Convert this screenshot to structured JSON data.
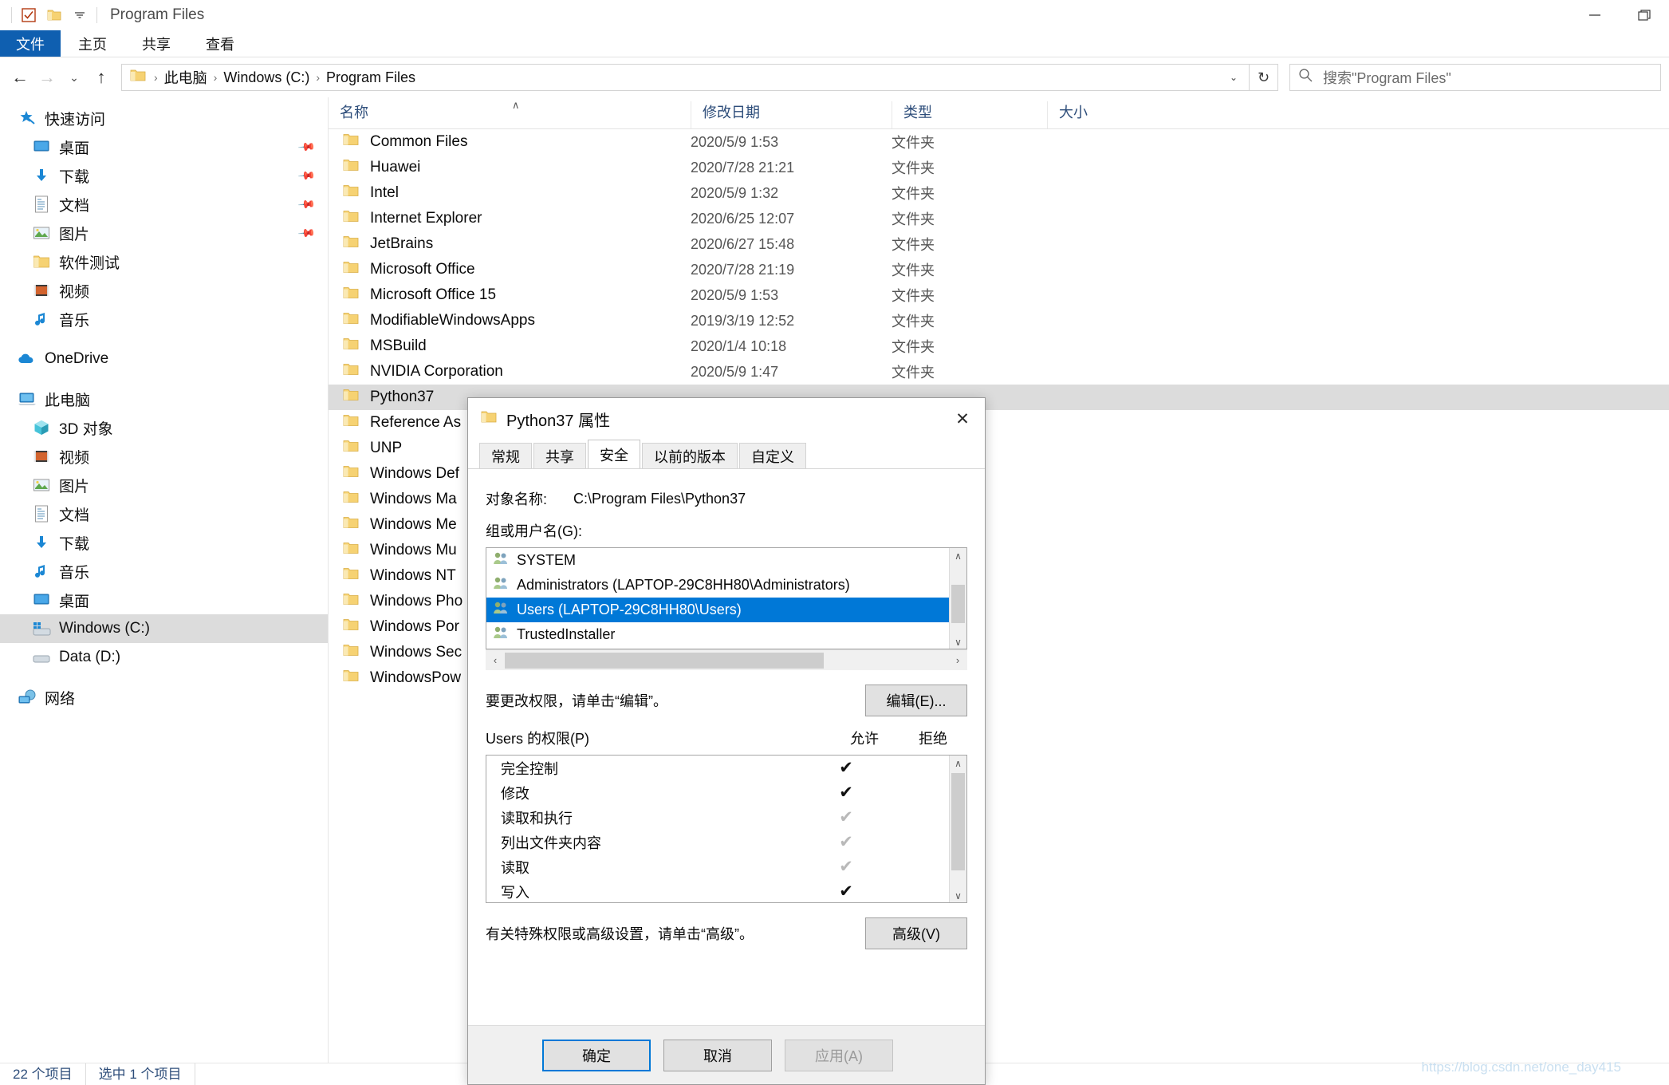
{
  "window": {
    "title": "Program Files",
    "quick_access_icons": [
      "properties-checkbox-icon",
      "folder-icon",
      "chevron-down-icon"
    ],
    "controls": {
      "minimize": "—",
      "maximize": "❐",
      "close": ""
    }
  },
  "ribbon": {
    "tabs": [
      {
        "label": "文件",
        "active_style": "file"
      },
      {
        "label": "主页"
      },
      {
        "label": "共享"
      },
      {
        "label": "查看"
      }
    ]
  },
  "address": {
    "back": "←",
    "forward": "→",
    "recent": "⌄",
    "up": "↑",
    "crumbs": [
      "此电脑",
      "Windows (C:)",
      "Program Files"
    ],
    "separator": "›",
    "dropdown": "⌄",
    "refresh": "↻"
  },
  "search": {
    "placeholder": "搜索\"Program Files\"",
    "icon": "search-icon"
  },
  "sidebar": {
    "groups": [
      {
        "root": {
          "label": "快速访问",
          "icon": "star-pin-icon"
        },
        "items": [
          {
            "label": "桌面",
            "icon": "desktop-icon",
            "pinned": true
          },
          {
            "label": "下载",
            "icon": "download-icon",
            "pinned": true
          },
          {
            "label": "文档",
            "icon": "documents-icon",
            "pinned": true
          },
          {
            "label": "图片",
            "icon": "pictures-icon",
            "pinned": true
          },
          {
            "label": "软件测试",
            "icon": "folder-icon",
            "pinned": false
          },
          {
            "label": "视频",
            "icon": "videos-icon",
            "pinned": false
          },
          {
            "label": "音乐",
            "icon": "music-icon",
            "pinned": false
          }
        ]
      },
      {
        "root": {
          "label": "OneDrive",
          "icon": "onedrive-cloud-icon"
        },
        "items": []
      },
      {
        "root": {
          "label": "此电脑",
          "icon": "this-pc-icon"
        },
        "items": [
          {
            "label": "3D 对象",
            "icon": "3d-objects-icon",
            "pinned": false
          },
          {
            "label": "视频",
            "icon": "videos-icon",
            "pinned": false
          },
          {
            "label": "图片",
            "icon": "pictures-icon",
            "pinned": false
          },
          {
            "label": "文档",
            "icon": "documents-icon",
            "pinned": false
          },
          {
            "label": "下载",
            "icon": "download-icon",
            "pinned": false
          },
          {
            "label": "音乐",
            "icon": "music-icon",
            "pinned": false
          },
          {
            "label": "桌面",
            "icon": "desktop-icon",
            "pinned": false
          },
          {
            "label": "Windows (C:)",
            "icon": "windows-drive-icon",
            "pinned": false,
            "selected": true
          },
          {
            "label": "Data (D:)",
            "icon": "drive-icon",
            "pinned": false
          }
        ]
      },
      {
        "root": {
          "label": "网络",
          "icon": "network-icon"
        },
        "items": []
      }
    ]
  },
  "filelist": {
    "columns": [
      {
        "label": "名称",
        "key": "name"
      },
      {
        "label": "修改日期",
        "key": "date"
      },
      {
        "label": "类型",
        "key": "type"
      },
      {
        "label": "大小",
        "key": "size"
      }
    ],
    "sort_indicator": "∧",
    "rows": [
      {
        "name": "Common Files",
        "date": "2020/5/9 1:53",
        "type": "文件夹",
        "size": ""
      },
      {
        "name": "Huawei",
        "date": "2020/7/28 21:21",
        "type": "文件夹",
        "size": ""
      },
      {
        "name": "Intel",
        "date": "2020/5/9 1:32",
        "type": "文件夹",
        "size": ""
      },
      {
        "name": "Internet Explorer",
        "date": "2020/6/25 12:07",
        "type": "文件夹",
        "size": ""
      },
      {
        "name": "JetBrains",
        "date": "2020/6/27 15:48",
        "type": "文件夹",
        "size": ""
      },
      {
        "name": "Microsoft Office",
        "date": "2020/7/28 21:19",
        "type": "文件夹",
        "size": ""
      },
      {
        "name": "Microsoft Office 15",
        "date": "2020/5/9 1:53",
        "type": "文件夹",
        "size": ""
      },
      {
        "name": "ModifiableWindowsApps",
        "date": "2019/3/19 12:52",
        "type": "文件夹",
        "size": ""
      },
      {
        "name": "MSBuild",
        "date": "2020/1/4 10:18",
        "type": "文件夹",
        "size": ""
      },
      {
        "name": "NVIDIA Corporation",
        "date": "2020/5/9 1:47",
        "type": "文件夹",
        "size": ""
      },
      {
        "name": "Python37",
        "date": "",
        "type": "",
        "size": "",
        "selected": true
      },
      {
        "name": "Reference As",
        "date": "",
        "type": "",
        "size": ""
      },
      {
        "name": "UNP",
        "date": "",
        "type": "",
        "size": ""
      },
      {
        "name": "Windows Def",
        "date": "",
        "type": "",
        "size": ""
      },
      {
        "name": "Windows Ma",
        "date": "",
        "type": "",
        "size": ""
      },
      {
        "name": "Windows Me",
        "date": "",
        "type": "",
        "size": ""
      },
      {
        "name": "Windows Mu",
        "date": "",
        "type": "",
        "size": ""
      },
      {
        "name": "Windows NT",
        "date": "",
        "type": "",
        "size": ""
      },
      {
        "name": "Windows Pho",
        "date": "",
        "type": "",
        "size": ""
      },
      {
        "name": "Windows Por",
        "date": "",
        "type": "",
        "size": ""
      },
      {
        "name": "Windows Sec",
        "date": "",
        "type": "",
        "size": ""
      },
      {
        "name": "WindowsPow",
        "date": "",
        "type": "",
        "size": ""
      }
    ]
  },
  "statusbar": {
    "item_count": "22 个项目",
    "selection": "选中 1 个项目"
  },
  "watermark": "https://blog.csdn.net/one_day415",
  "dialog": {
    "title": "Python37 属性",
    "close_glyph": "✕",
    "tabs": [
      {
        "label": "常规",
        "active": false
      },
      {
        "label": "共享",
        "active": false
      },
      {
        "label": "安全",
        "active": true
      },
      {
        "label": "以前的版本",
        "active": false
      },
      {
        "label": "自定义",
        "active": false
      }
    ],
    "object_name_label": "对象名称:",
    "object_name_value": "C:\\Program Files\\Python37",
    "group_label": "组或用户名(G):",
    "groups": [
      {
        "name": "SYSTEM",
        "selected": false
      },
      {
        "name": "Administrators (LAPTOP-29C8HH80\\Administrators)",
        "selected": false
      },
      {
        "name": "Users (LAPTOP-29C8HH80\\Users)",
        "selected": true
      },
      {
        "name": "TrustedInstaller",
        "selected": false
      }
    ],
    "edit_hint": "要更改权限，请单击“编辑”。",
    "edit_button": "编辑(E)...",
    "permissions_title": "Users 的权限(P)",
    "allow_col": "允许",
    "deny_col": "拒绝",
    "permissions": [
      {
        "name": "完全控制",
        "allow": "checked",
        "deny": "none"
      },
      {
        "name": "修改",
        "allow": "checked",
        "deny": "none"
      },
      {
        "name": "读取和执行",
        "allow": "dimmed",
        "deny": "none"
      },
      {
        "name": "列出文件夹内容",
        "allow": "dimmed",
        "deny": "none"
      },
      {
        "name": "读取",
        "allow": "dimmed",
        "deny": "none"
      },
      {
        "name": "写入",
        "allow": "checked",
        "deny": "none"
      }
    ],
    "advanced_hint": "有关特殊权限或高级设置，请单击“高级”。",
    "advanced_button": "高级(V)",
    "ok_button": "确定",
    "cancel_button": "取消",
    "apply_button": "应用(A)",
    "check_glyph": "✔",
    "scroll_up_glyph": "∧",
    "scroll_down_glyph": "∨",
    "scroll_left_glyph": "‹",
    "scroll_right_glyph": "›"
  },
  "colors": {
    "accent": "#0078d7",
    "file_tab": "#0f5fb0",
    "selection_gray": "#dcdcdc",
    "folder_yellow": "#f7d26a"
  }
}
